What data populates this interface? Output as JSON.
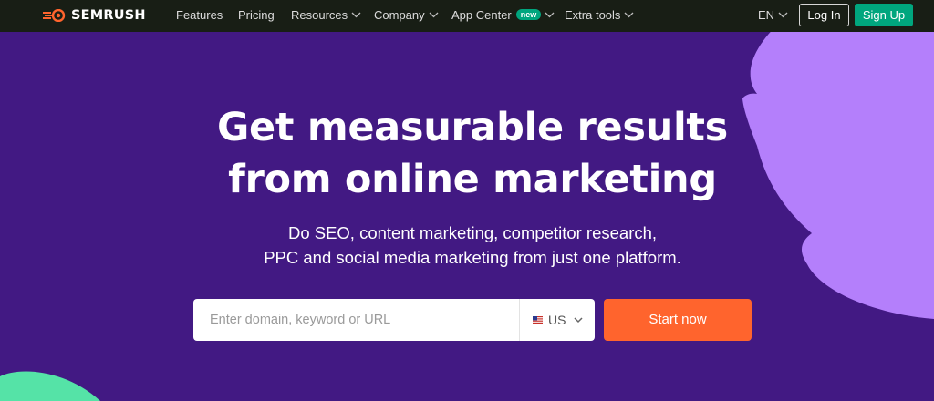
{
  "brand": {
    "name": "SEMRUSH",
    "logo_icon": "semrush-fireball-icon"
  },
  "nav": {
    "links": [
      {
        "label": "Features"
      },
      {
        "label": "Pricing"
      },
      {
        "label": "Resources"
      },
      {
        "label": "Company"
      },
      {
        "label": "App Center",
        "badge": "new"
      },
      {
        "label": "Extra tools"
      }
    ],
    "language": "EN",
    "login_label": "Log In",
    "signup_label": "Sign Up"
  },
  "hero": {
    "headline_line1": "Get measurable results",
    "headline_line2": "from online marketing",
    "subhead_line1": "Do SEO, content marketing, competitor research,",
    "subhead_line2": "PPC and social media marketing from just one platform."
  },
  "search": {
    "placeholder": "Enter domain, keyword or URL",
    "value": "",
    "country_code": "US",
    "country_flag_icon": "us-flag-icon",
    "submit_label": "Start now"
  },
  "colors": {
    "background": "#421983",
    "nav_background": "#181e15",
    "accent_orange": "#ff642d",
    "accent_green": "#00a67e",
    "decor_purple": "#b47ffb",
    "decor_green": "#55e3a7"
  }
}
